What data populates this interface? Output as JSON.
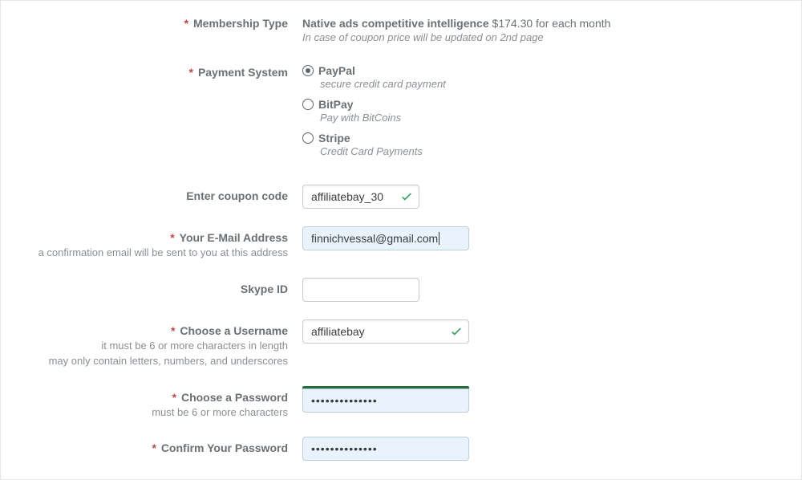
{
  "membership": {
    "label": "Membership Type",
    "product": "Native ads competitive intelligence",
    "price_suffix": " $174.30 for each month",
    "note": "In case of coupon price will be updated on 2nd page"
  },
  "payment": {
    "label": "Payment System",
    "options": [
      {
        "name": "PayPal",
        "sub": "secure credit card payment",
        "selected": true
      },
      {
        "name": "BitPay",
        "sub": "Pay with BitCoins",
        "selected": false
      },
      {
        "name": "Stripe",
        "sub": "Credit Card Payments",
        "selected": false
      }
    ]
  },
  "coupon": {
    "label": "Enter coupon code",
    "value": "affiliatebay_30",
    "valid": true
  },
  "email": {
    "label": "Your E-Mail Address",
    "value": "finnichvessal@gmail.com",
    "hint": "a confirmation email will be sent to you at this address"
  },
  "skype": {
    "label": "Skype ID",
    "value": ""
  },
  "username": {
    "label": "Choose a Username",
    "value": "affiliatebay",
    "valid": true,
    "hint1": "it must be 6 or more characters in length",
    "hint2": "may only contain letters, numbers, and underscores"
  },
  "password": {
    "label": "Choose a Password",
    "masked": "••••••••••••••",
    "hint": "must be 6 or more characters"
  },
  "confirm": {
    "label": "Confirm Your Password",
    "masked": "••••••••••••••"
  }
}
